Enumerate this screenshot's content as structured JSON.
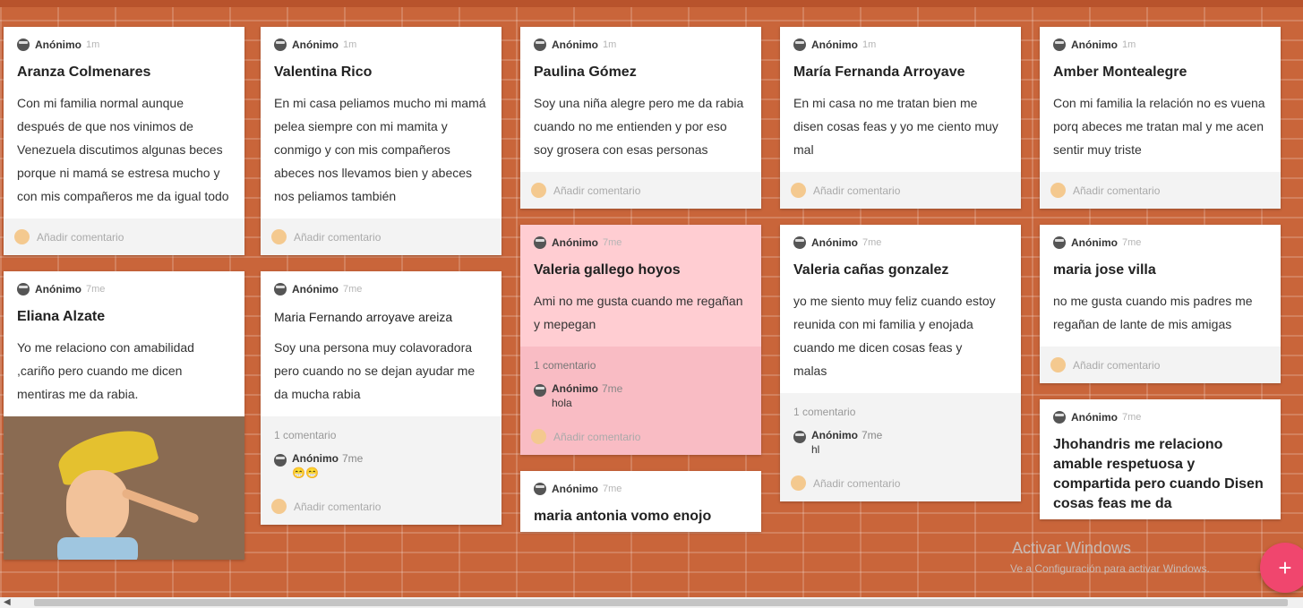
{
  "placeholder_comment": "Añadir comentario",
  "columns": [
    [
      {
        "author": "Anónimo",
        "time": "1m",
        "title": "Aranza Colmenares",
        "body": "Con mi familia normal aunque después de que nos vinimos de Venezuela discutimos algunas beces porque ni mamá se estresa mucho y con mis compañeros me da igual todo",
        "footer": "Añadir comentario"
      },
      {
        "author": "Anónimo",
        "time": "7me",
        "title": "Eliana Alzate",
        "body": "Yo me relaciono con amabilidad ,cariño pero cuando me dicen mentiras me da rabia.",
        "image": "pinocchio-illustration"
      }
    ],
    [
      {
        "author": "Anónimo",
        "time": "1m",
        "title": "Valentina Rico",
        "body": "En mi casa peliamos mucho mi mamá pelea siempre con mi mamita y conmigo y con mis compañeros abeces nos llevamos bien y abeces nos peliamos también",
        "footer": "Añadir comentario"
      },
      {
        "author": "Anónimo",
        "time": "7me",
        "title": "Maria  Fernando arroyave areiza",
        "body": "Soy una persona muy colavoradora pero cuando no se dejan ayudar me da mucha rabia",
        "comment_count": "1 comentario",
        "comment": {
          "author": "Anónimo",
          "time": "7me",
          "text": "😁😁"
        },
        "footer": "Añadir comentario"
      }
    ],
    [
      {
        "author": "Anónimo",
        "time": "1m",
        "title": "Paulina Gómez",
        "body": "Soy una niña alegre pero me da rabia cuando no me entienden y por eso soy grosera con esas personas",
        "footer": "Añadir comentario"
      },
      {
        "author": "Anónimo",
        "time": "7me",
        "title": "Valeria gallego hoyos",
        "body": "Ami no me gusta cuando me regañan y mepegan",
        "comment_count": "1 comentario",
        "comment": {
          "author": "Anónimo",
          "time": "7me",
          "text": "hola"
        },
        "footer": "Añadir comentario",
        "pink": true
      },
      {
        "author": "Anónimo",
        "time": "7me",
        "title": "maria antonia vomo enojo"
      }
    ],
    [
      {
        "author": "Anónimo",
        "time": "1m",
        "title": "María Fernanda Arroyave",
        "body": "En mi casa no me tratan bien me disen cosas feas y yo me ciento muy mal",
        "footer": "Añadir comentario"
      },
      {
        "author": "Anónimo",
        "time": "7me",
        "title": "Valeria cañas gonzalez",
        "body": "yo me siento muy feliz cuando estoy reunida con mi familia  y enojada cuando me dicen cosas feas y\n malas",
        "comment_count": "1 comentario",
        "comment": {
          "author": "Anónimo",
          "time": "7me",
          "text": "hl"
        },
        "footer": "Añadir comentario"
      }
    ],
    [
      {
        "author": "Anónimo",
        "time": "1m",
        "title": "Amber Montealegre",
        "body": "Con mi familia la relación no es vuena porq abeces me tratan mal y me acen sentir muy triste",
        "footer": "Añadir comentario"
      },
      {
        "author": "Anónimo",
        "time": "7me",
        "title": "maria jose villa",
        "body": "no me gusta cuando mis padres me regañan de lante de mis amigas",
        "footer": "Añadir comentario"
      },
      {
        "author": "Anónimo",
        "time": "7me",
        "title": "Jhohandris me relaciono amable respetuosa y compartida pero cuando Disen cosas feas me da"
      }
    ]
  ],
  "watermark": {
    "line1": "Activar Windows",
    "line2": "Ve a Configuración para activar Windows."
  },
  "fab_label": "+"
}
